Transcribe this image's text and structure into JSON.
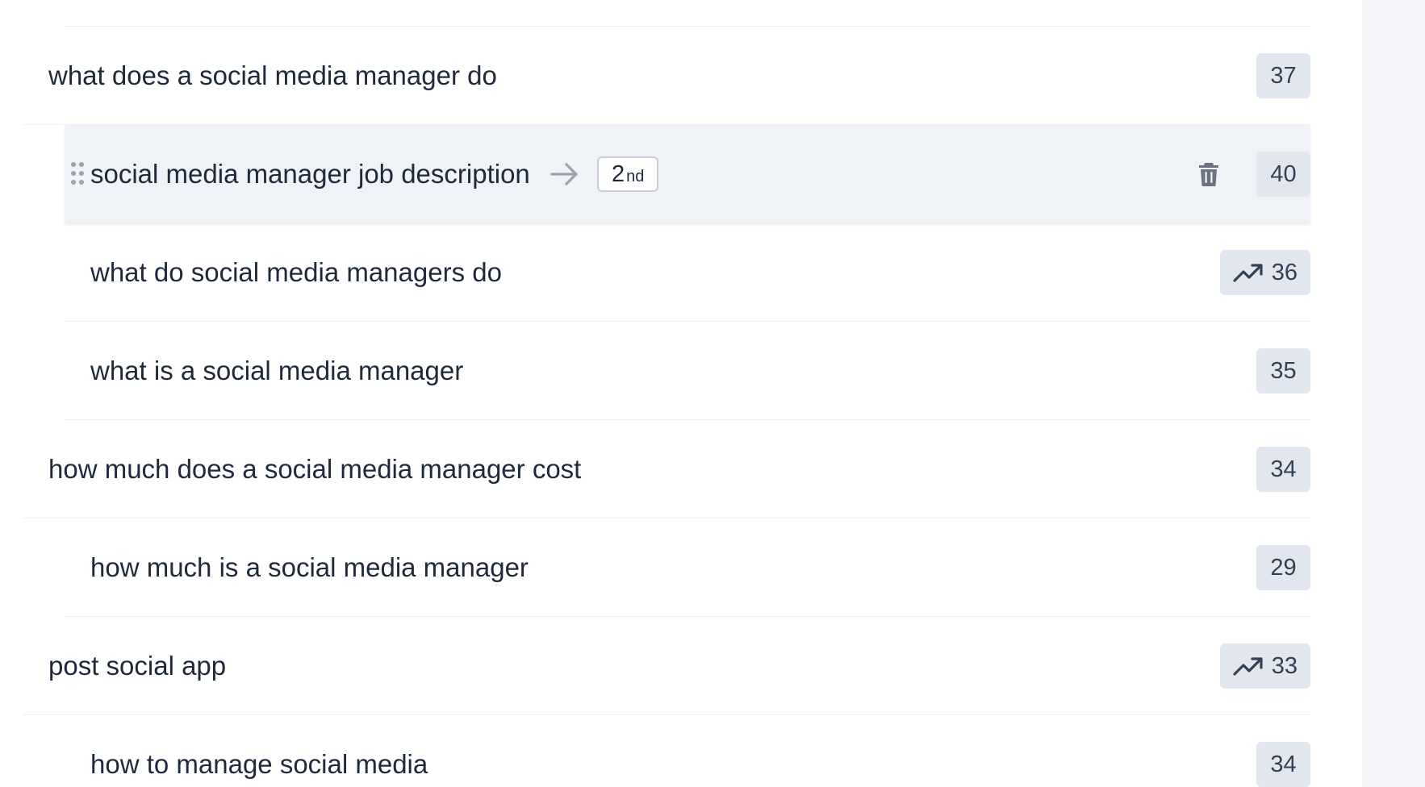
{
  "rows": [
    {
      "text": "what does a social media manager do",
      "count": "37"
    },
    {
      "text": "social media manager job description",
      "count": "40",
      "rank_number": "2",
      "rank_suffix": "nd"
    },
    {
      "text": "what do social media managers do",
      "count": "36",
      "trend_icon": "trending-up-icon"
    },
    {
      "text": "what is a social media manager",
      "count": "35"
    },
    {
      "text": "how much does a social media manager cost",
      "count": "34"
    },
    {
      "text": "how much is a social media manager",
      "count": "29"
    },
    {
      "text": "post social app",
      "count": "33",
      "trend_icon": "trending-up-icon"
    },
    {
      "text": "how to manage social media",
      "count": "34"
    }
  ],
  "icons": {
    "drag": "drag-handle-icon",
    "arrow": "arrow-right-icon",
    "delete": "trash-icon",
    "trend": "trending-up-icon"
  },
  "colors": {
    "highlight_row": "#eff2f7",
    "count_badge": "#e2e7ef",
    "text": "#1e293b",
    "right_panel": "#f3f5f9"
  }
}
